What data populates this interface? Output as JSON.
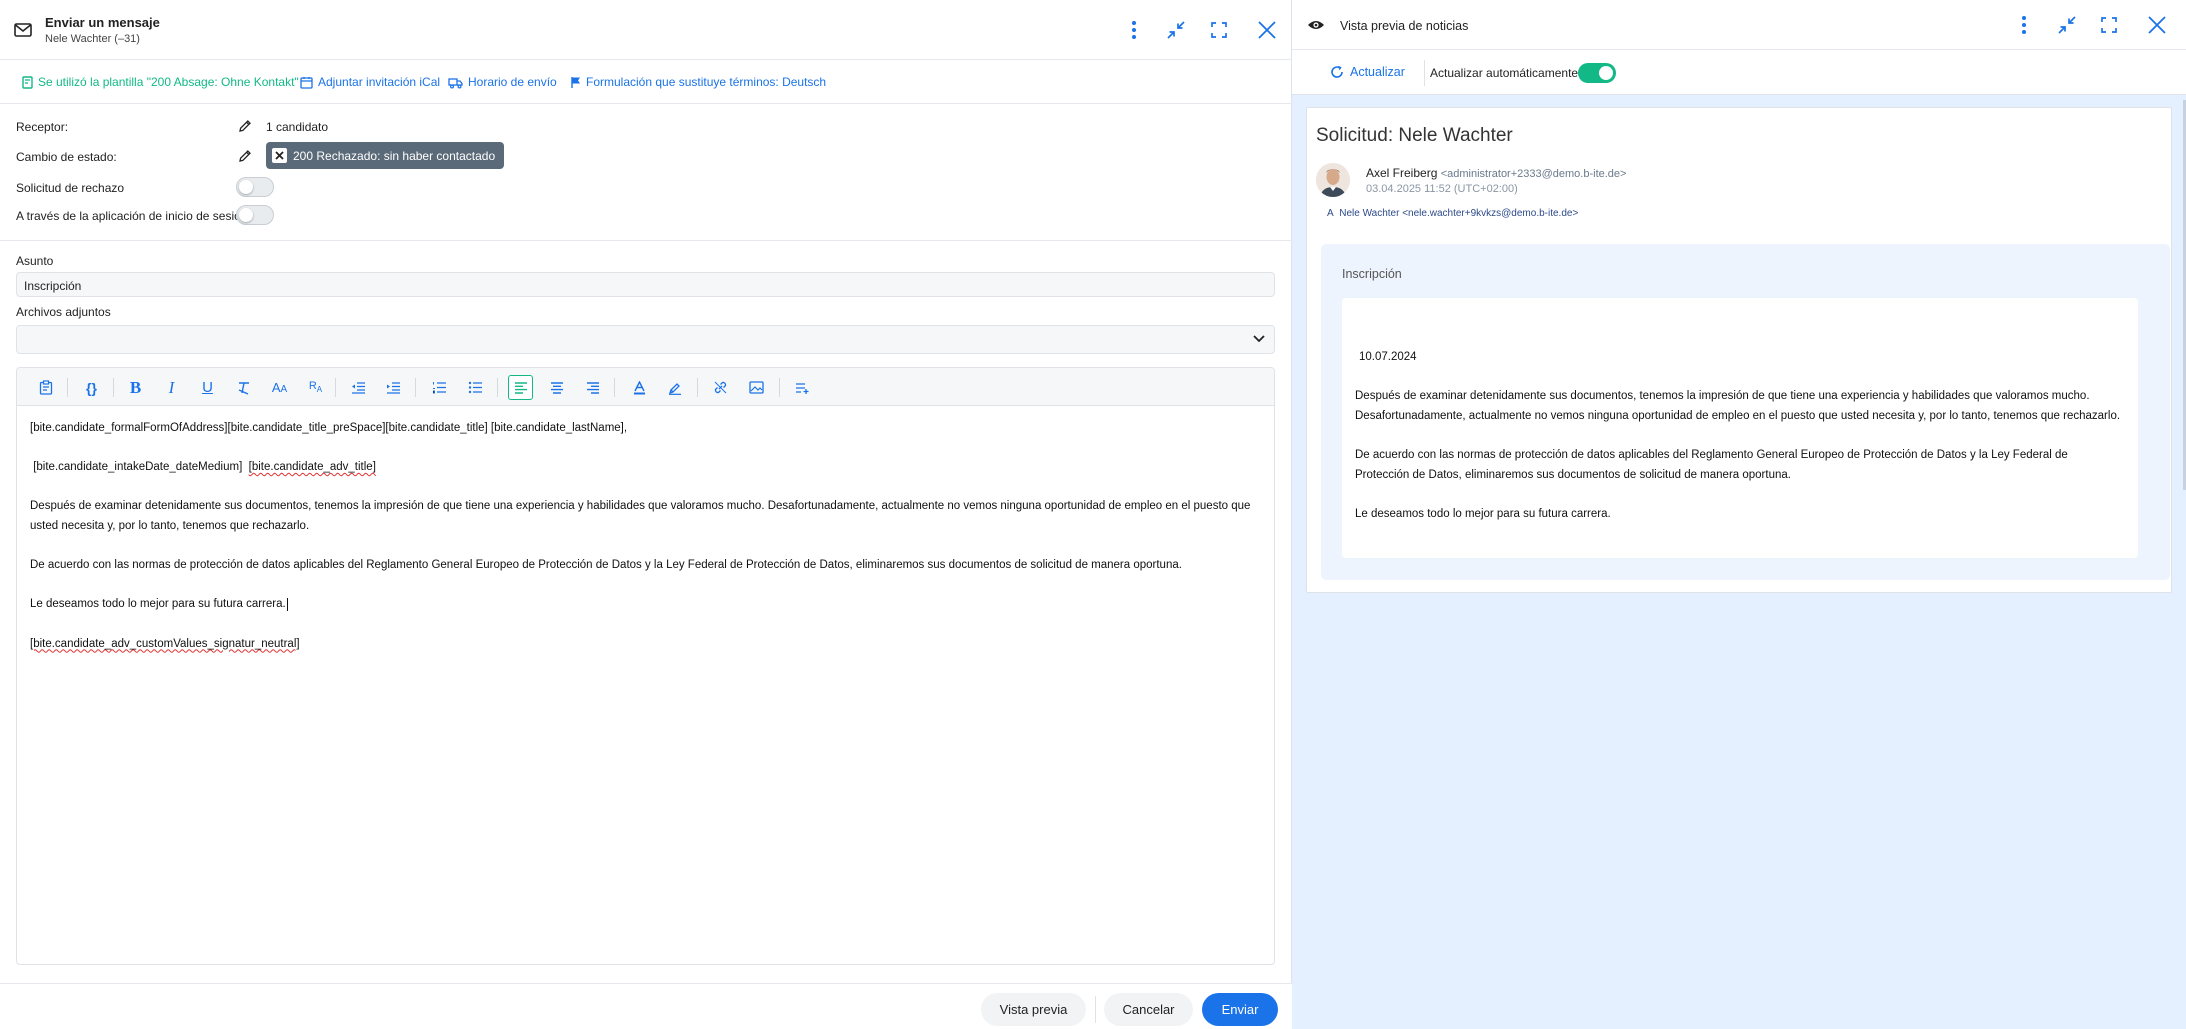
{
  "compose": {
    "title": "Enviar un mensaje",
    "subtitle": "Nele Wachter (–31)"
  },
  "toolbar": {
    "template": "Se utilizó la plantilla \"200 Absage: Ohne Kontakt\"",
    "ical": "Adjuntar invitación iCal",
    "schedule": "Horario de envío",
    "formulation": "Formulación que sustituye términos: Deutsch"
  },
  "form": {
    "receiver_label": "Receptor:",
    "receiver_value": "1 candidato",
    "status_label": "Cambio de estado:",
    "status_value": "200 Rechazado: sin haber contactado",
    "rejection_label": "Solicitud de rechazo",
    "login_app_label": "A través de la aplicación de inicio de sesión",
    "subject_label": "Asunto",
    "subject_value": "Inscripción",
    "attachments_label": "Archivos adjuntos"
  },
  "editor": {
    "line1": "[bite.candidate_formalFormOfAddress][bite.candidate_title_preSpace][bite.candidate_title] [bite.candidate_lastName],",
    "line2a": "[bite.candidate_intakeDate_dateMedium]",
    "line2b": "[bite.candidate_adv_title]",
    "para1": "Después de examinar detenidamente sus documentos, tenemos la impresión de que tiene una experiencia y habilidades que valoramos mucho. Desafortunadamente, actualmente no vemos ninguna oportunidad de empleo en el puesto que usted necesita y, por lo tanto, tenemos que rechazarlo.",
    "para2": "De acuerdo con las normas de protección de datos aplicables del Reglamento General Europeo de Protección de Datos y la Ley Federal de Protección de Datos, eliminaremos sus documentos de solicitud de manera oportuna.",
    "para3": "Le deseamos todo lo mejor para su futura carrera.",
    "signature": "[bite.candidate_adv_customValues_signatur_neutral]"
  },
  "footer": {
    "preview": "Vista previa",
    "cancel": "Cancelar",
    "send": "Enviar"
  },
  "preview": {
    "title": "Vista previa de noticias",
    "refresh": "Actualizar",
    "auto_refresh": "Actualizar automáticamente",
    "heading": "Solicitud:  Nele Wachter",
    "sender_name": "Axel Freiberg",
    "sender_email": "<administrator+2333@demo.b-ite.de>",
    "date": "03.04.2025 11:52 (UTC+02:00)",
    "to_prefix": "A",
    "to": "Nele Wachter <nele.wachter+9kvkzs@demo.b-ite.de>",
    "subject": "Inscripción",
    "body_date": "10.07.2024",
    "body_para1": "Después de examinar detenidamente sus documentos, tenemos la impresión de que tiene una experiencia y habilidades que valoramos mucho. Desafortunadamente, actualmente no vemos ninguna oportunidad de empleo en el puesto que usted necesita y, por lo tanto, tenemos que rechazarlo.",
    "body_para2": "De acuerdo con las normas de protección de datos aplicables del Reglamento General Europeo de Protección de Datos y la Ley Federal de Protección de Datos, eliminaremos sus documentos de solicitud de manera oportuna.",
    "body_para3": "Le deseamos todo lo mejor para su futura carrera."
  },
  "colors": {
    "accent_blue": "#1a73e8",
    "accent_green": "#12b886",
    "chip_bg": "#5b6a78",
    "preview_bg": "#e4efff"
  }
}
